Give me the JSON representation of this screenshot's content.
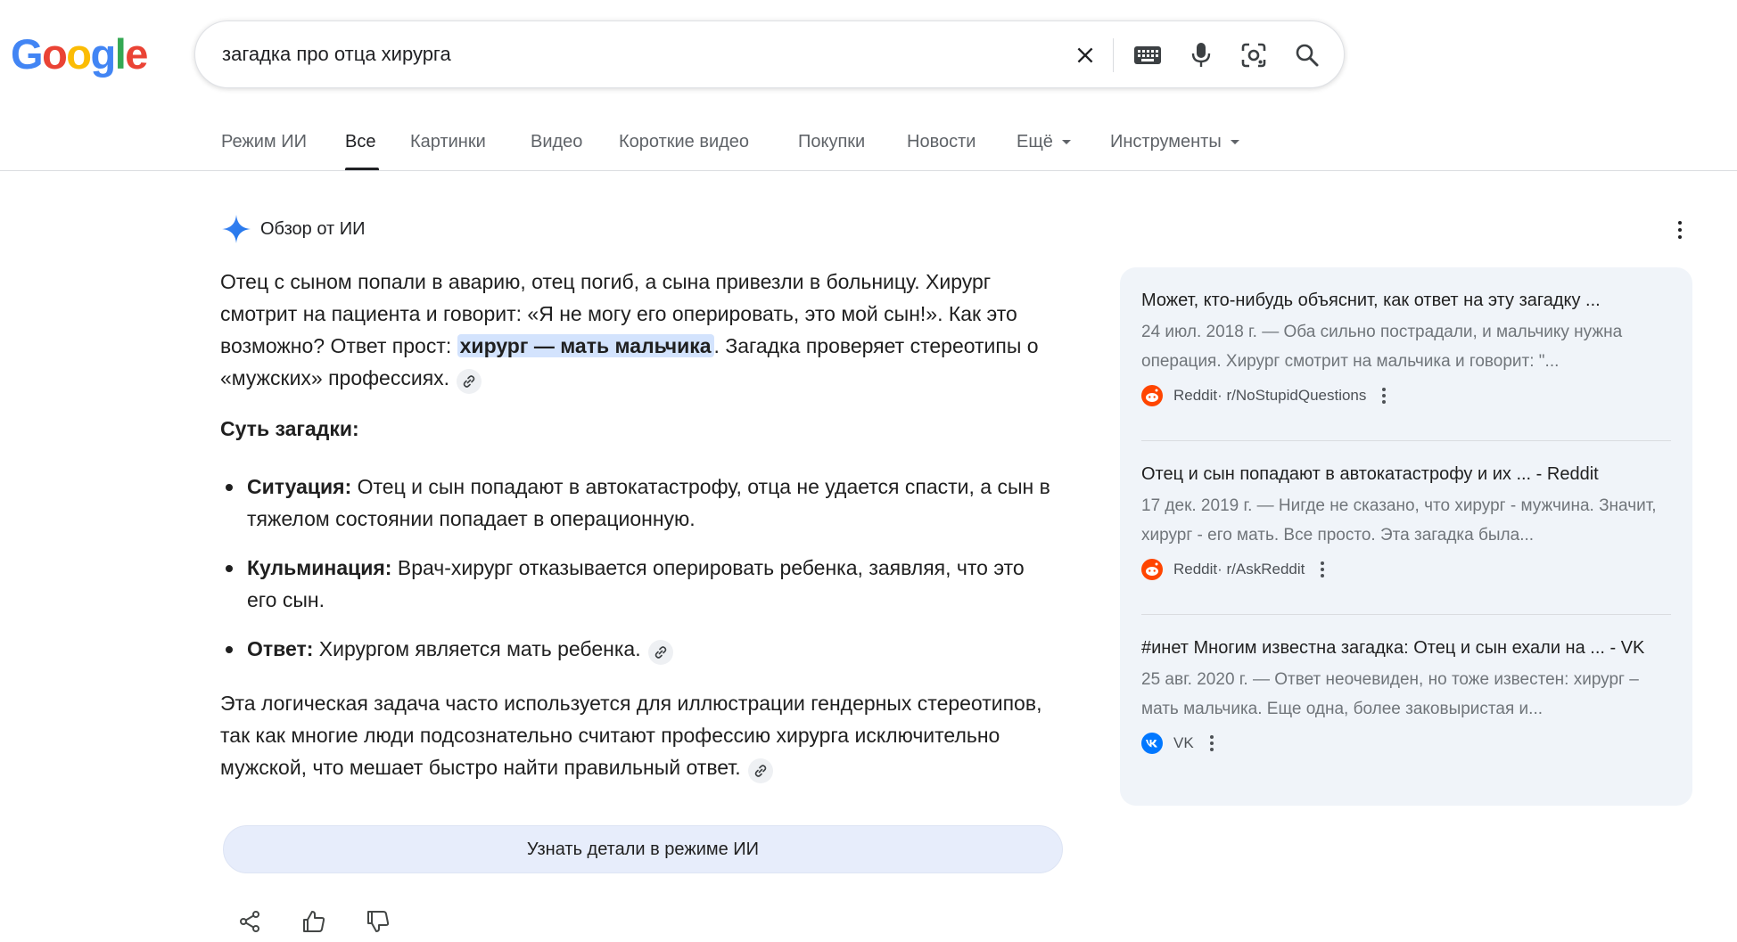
{
  "logo": {
    "letters": [
      "G",
      "o",
      "o",
      "g",
      "l",
      "e"
    ]
  },
  "search": {
    "query": "загадка про отца хирурга",
    "icons": [
      "close-icon",
      "keyboard-icon",
      "microphone-icon",
      "lens-icon",
      "search-icon"
    ]
  },
  "tabs": [
    {
      "label": "Режим ИИ",
      "active": false
    },
    {
      "label": "Все",
      "active": true
    },
    {
      "label": "Картинки",
      "active": false
    },
    {
      "label": "Видео",
      "active": false
    },
    {
      "label": "Короткие видео",
      "active": false
    },
    {
      "label": "Покупки",
      "active": false
    },
    {
      "label": "Новости",
      "active": false
    },
    {
      "label": "Ещё",
      "active": false
    },
    {
      "label": "Инструменты",
      "active": false
    }
  ],
  "ai_overview": {
    "label": "Обзор от ИИ",
    "intro_before": "Отец с сыном попали в аварию, отец погиб, а сына привезли в больницу. Хирург смотрит на пациента и говорит: «Я не могу его оперировать, это мой сын!». Как это возможно? Ответ прост: ",
    "intro_highlight": "хирург — мать мальчика",
    "intro_after": ". Загадка проверяет стереотипы о «мужских» профессиях.",
    "section_title": "Суть загадки:",
    "bullets": [
      {
        "term": "Ситуация:",
        "text": " Отец и сын попадают в автокатастрофу, отца не удается спасти, а сын в тяжелом состоянии попадает в операционную."
      },
      {
        "term": "Кульминация:",
        "text": " Врач-хирург отказывается оперировать ребенка, заявляя, что это его сын."
      },
      {
        "term": "Ответ:",
        "text": " Хирургом является мать ребенка."
      }
    ],
    "conclusion": "Эта логическая задача часто используется для иллюстрации гендерных стереотипов, так как многие люди подсознательно считают профессию хирурга исключительно мужской, что мешает быстро найти правильный ответ.",
    "ai_mode_button": "Узнать детали в режиме ИИ"
  },
  "sources": [
    {
      "title": "Может, кто-нибудь объяснит, как ответ на эту загадку ...",
      "snippet": "24 июл. 2018 г. — Оба сильно пострадали, и мальчику нужна операция. Хирург смотрит на мальчика и говорит: \"...",
      "site": "Reddit",
      "path": " · r/NoStupidQuestions",
      "favicon": "reddit-icon"
    },
    {
      "title": "Отец и сын попадают в автокатастрофу и их ... - Reddit",
      "snippet": "17 дек. 2019 г. — Нигде не сказано, что хирург - мужчина. Значит, хирург - его мать. Все просто. Эта загадка была...",
      "site": "Reddit",
      "path": " · r/AskReddit",
      "favicon": "reddit-icon"
    },
    {
      "title": "#инет Многим известна загадка: Отец и сын ехали на ... - VK",
      "snippet": "25 авг. 2020 г. — Ответ неочевиден, но тоже известен: хирург – мать мальчика. Еще одна, более заковыристая и...",
      "site": "VK",
      "path": "",
      "favicon": "vk-icon"
    }
  ],
  "colors": {
    "google_blue": "#4285F4",
    "google_red": "#EA4335",
    "google_yellow": "#FBBC05",
    "google_green": "#34A853",
    "highlight": "#d3e3fd",
    "panel": "#f0f4f9",
    "reddit": "#FF4500",
    "vk": "#0077FF"
  }
}
